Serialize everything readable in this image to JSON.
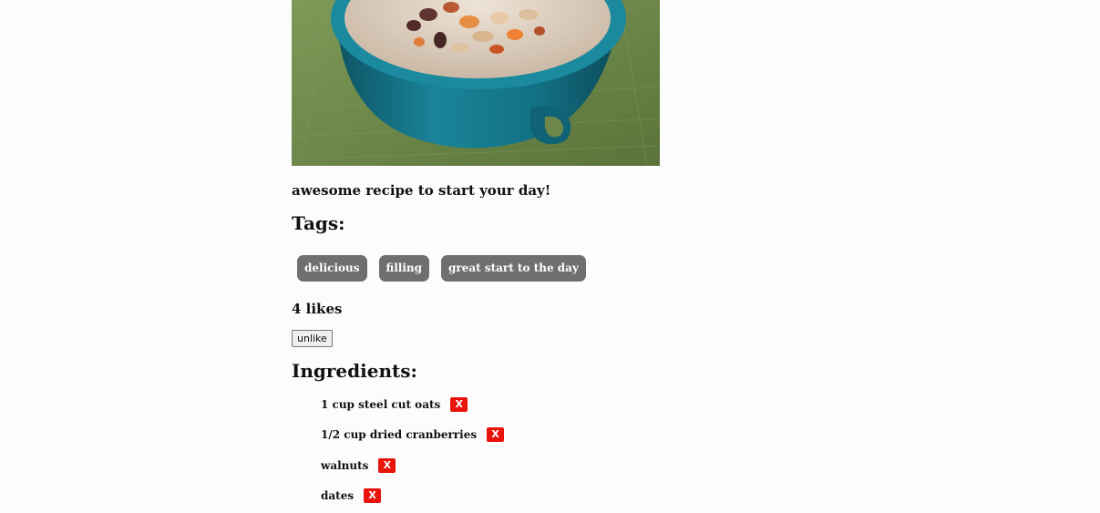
{
  "recipe": {
    "image_alt": "bowl of oatmeal topped with almonds, raisins and apricots",
    "description": "awesome recipe to start your day!",
    "tags_heading": "Tags:",
    "tags": [
      "delicious",
      "filling",
      "great start to the day"
    ],
    "likes_text": "4 likes",
    "unlike_label": "unlike",
    "ingredients_heading": "Ingredients:",
    "ingredients": [
      {
        "name": "1 cup steel cut oats",
        "remove_label": "X"
      },
      {
        "name": "1/2 cup dried cranberries",
        "remove_label": "X"
      },
      {
        "name": "walnuts",
        "remove_label": "X"
      },
      {
        "name": "dates",
        "remove_label": "X"
      }
    ]
  },
  "colors": {
    "page_background": "#fdfcfc",
    "tag_background": "#6f6f6f",
    "remove_button": "#e8140c",
    "bowl": "#16778a",
    "tablecloth": "#6f8a4e"
  }
}
